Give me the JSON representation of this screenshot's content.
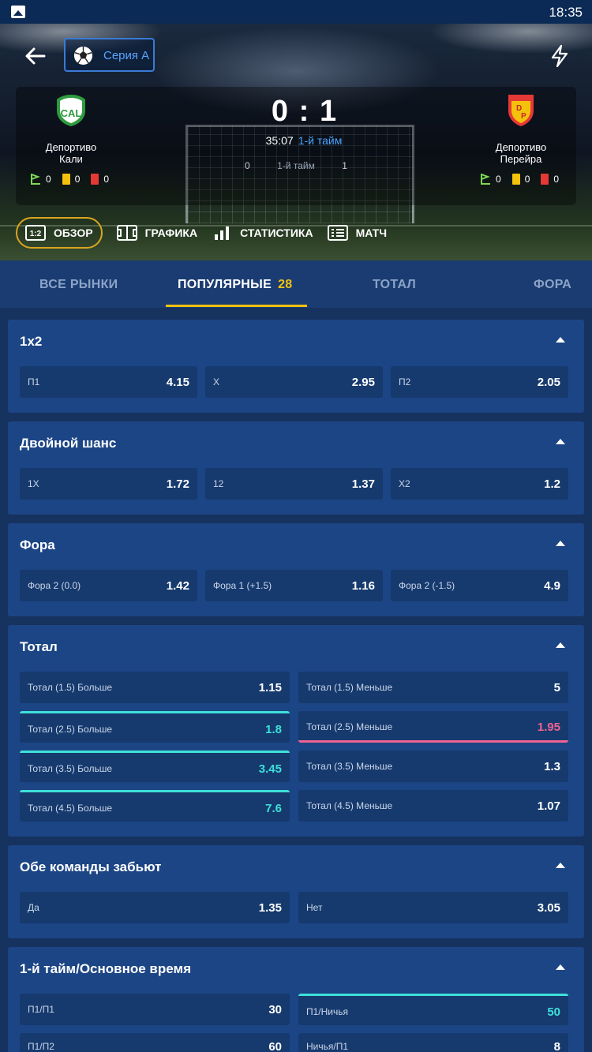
{
  "status_bar": {
    "time": "18:35"
  },
  "header": {
    "league": "Серия А",
    "home": {
      "name_line1": "Депортиво",
      "name_line2": "Кали",
      "corners": "0",
      "yellow": "0",
      "red": "0"
    },
    "away": {
      "name_line1": "Депортиво",
      "name_line2": "Перейра",
      "corners": "0",
      "yellow": "0",
      "red": "0"
    },
    "score_home": "0",
    "score_sep": ":",
    "score_away": "1",
    "clock": "35:07",
    "period": "1-й тайм",
    "half_label": "1-й тайм",
    "half_home": "0",
    "half_away": "1",
    "tabs": [
      {
        "label": "ОБЗОР",
        "icon": "scoreboard-icon"
      },
      {
        "label": "ГРАФИКА",
        "icon": "field-icon"
      },
      {
        "label": "СТАТИСТИКА",
        "icon": "bar-chart-icon"
      },
      {
        "label": "МАТЧ",
        "icon": "list-icon"
      }
    ]
  },
  "market_tabs": [
    {
      "label": "ВСЕ РЫНКИ"
    },
    {
      "label": "ПОПУЛЯРНЫЕ",
      "count": "28"
    },
    {
      "label": "ТОТАЛ"
    },
    {
      "label": "ФОРА"
    }
  ],
  "sections": {
    "s1x2": {
      "title": "1x2",
      "cells": [
        {
          "l": "П1",
          "v": "4.15"
        },
        {
          "l": "X",
          "v": "2.95"
        },
        {
          "l": "П2",
          "v": "2.05"
        }
      ]
    },
    "double": {
      "title": "Двойной шанс",
      "cells": [
        {
          "l": "1X",
          "v": "1.72"
        },
        {
          "l": "12",
          "v": "1.37"
        },
        {
          "l": "X2",
          "v": "1.2"
        }
      ]
    },
    "fora": {
      "title": "Фора",
      "cells": [
        {
          "l": "Фора 2 (0.0)",
          "v": "1.42"
        },
        {
          "l": "Фора 1 (+1.5)",
          "v": "1.16"
        },
        {
          "l": "Фора 2 (-1.5)",
          "v": "4.9"
        }
      ]
    },
    "total": {
      "title": "Тотал",
      "cells": [
        {
          "l": "Тотал (1.5) Больше",
          "v": "1.15"
        },
        {
          "l": "Тотал (1.5) Меньше",
          "v": "5"
        },
        {
          "l": "Тотал (2.5) Больше",
          "v": "1.8"
        },
        {
          "l": "Тотал (2.5) Меньше",
          "v": "1.95"
        },
        {
          "l": "Тотал (3.5) Больше",
          "v": "3.45"
        },
        {
          "l": "Тотал (3.5) Меньше",
          "v": "1.3"
        },
        {
          "l": "Тотал (4.5) Больше",
          "v": "7.6"
        },
        {
          "l": "Тотал (4.5) Меньше",
          "v": "1.07"
        }
      ]
    },
    "both": {
      "title": "Обе команды забьют",
      "cells": [
        {
          "l": "Да",
          "v": "1.35"
        },
        {
          "l": "Нет",
          "v": "3.05"
        }
      ]
    },
    "ht": {
      "title": "1-й тайм/Основное время",
      "cells": [
        {
          "l": "П1/П1",
          "v": "30"
        },
        {
          "l": "П1/Ничья",
          "v": "50"
        },
        {
          "l": "П1/П2",
          "v": "60"
        },
        {
          "l": "Ничья/П1",
          "v": "8"
        }
      ]
    }
  },
  "colors": {
    "up": "#3ee0d8",
    "down": "#f06292",
    "accent": "#f4c20d",
    "bg": "#16325e"
  }
}
